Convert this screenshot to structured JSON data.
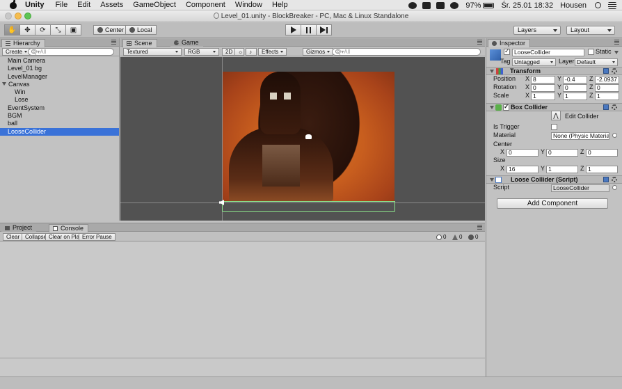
{
  "menubar": {
    "app": "Unity",
    "items": [
      "File",
      "Edit",
      "Assets",
      "GameObject",
      "Component",
      "Window",
      "Help"
    ],
    "battery": "97%",
    "datetime": "Śr. 25.01  18:32",
    "user": "Housen"
  },
  "window": {
    "title": "Level_01.unity - BlockBreaker - PC, Mac & Linux Standalone"
  },
  "toolbar": {
    "pivot_label": "Center",
    "space_label": "Local",
    "layers_label": "Layers",
    "layout_label": "Layout"
  },
  "hierarchy": {
    "tab": "Hierarchy",
    "create_label": "Create",
    "search_placeholder": "Q▾All",
    "items": [
      {
        "label": "Main Camera",
        "child": false,
        "selected": false
      },
      {
        "label": "Level_01 bg",
        "child": false,
        "selected": false
      },
      {
        "label": "LevelManager",
        "child": false,
        "selected": false
      },
      {
        "label": "Canvas",
        "child": false,
        "selected": false,
        "expanded": true
      },
      {
        "label": "Win",
        "child": true,
        "selected": false
      },
      {
        "label": "Lose",
        "child": true,
        "selected": false
      },
      {
        "label": "EventSystem",
        "child": false,
        "selected": false
      },
      {
        "label": "BGM",
        "child": false,
        "selected": false
      },
      {
        "label": "ball",
        "child": false,
        "selected": false
      },
      {
        "label": "LooseCollider",
        "child": false,
        "selected": true
      }
    ]
  },
  "scene": {
    "tab_scene": "Scene",
    "tab_game": "Game",
    "shading": "Textured",
    "render_mode": "RGB",
    "mode_2d": "2D",
    "effects": "Effects",
    "gizmos": "Gizmos",
    "search_placeholder": "Q▾All"
  },
  "console": {
    "tab_project": "Project",
    "tab_console": "Console",
    "buttons": [
      "Clear",
      "Collapse",
      "Clear on Play",
      "Error Pause"
    ],
    "info_count": "0",
    "warn_count": "0",
    "error_count": "0"
  },
  "inspector": {
    "tab": "Inspector",
    "object_name": "LooseCollider",
    "static_label": "Static",
    "tag_label": "Tag",
    "tag_value": "Untagged",
    "layer_label": "Layer",
    "layer_value": "Default",
    "transform": {
      "title": "Transform",
      "position_label": "Position",
      "rotation_label": "Rotation",
      "scale_label": "Scale",
      "position": {
        "x": "8",
        "y": "-0.4",
        "z": "-2.0937"
      },
      "rotation": {
        "x": "0",
        "y": "0",
        "z": "0"
      },
      "scale": {
        "x": "1",
        "y": "1",
        "z": "1"
      }
    },
    "box_collider": {
      "title": "Box Collider",
      "edit_label": "Edit Collider",
      "trigger_label": "Is Trigger",
      "material_label": "Material",
      "material_value": "None (Physic Material",
      "center_label": "Center",
      "size_label": "Size",
      "center": {
        "x": "0",
        "y": "0",
        "z": "0"
      },
      "size": {
        "x": "16",
        "y": "1",
        "z": "1"
      }
    },
    "script": {
      "title": "Loose Collider (Script)",
      "script_label": "Script",
      "script_value": "LooseCollider"
    },
    "add_component": "Add Component",
    "axis_x": "X",
    "axis_y": "Y",
    "axis_z": "Z"
  }
}
